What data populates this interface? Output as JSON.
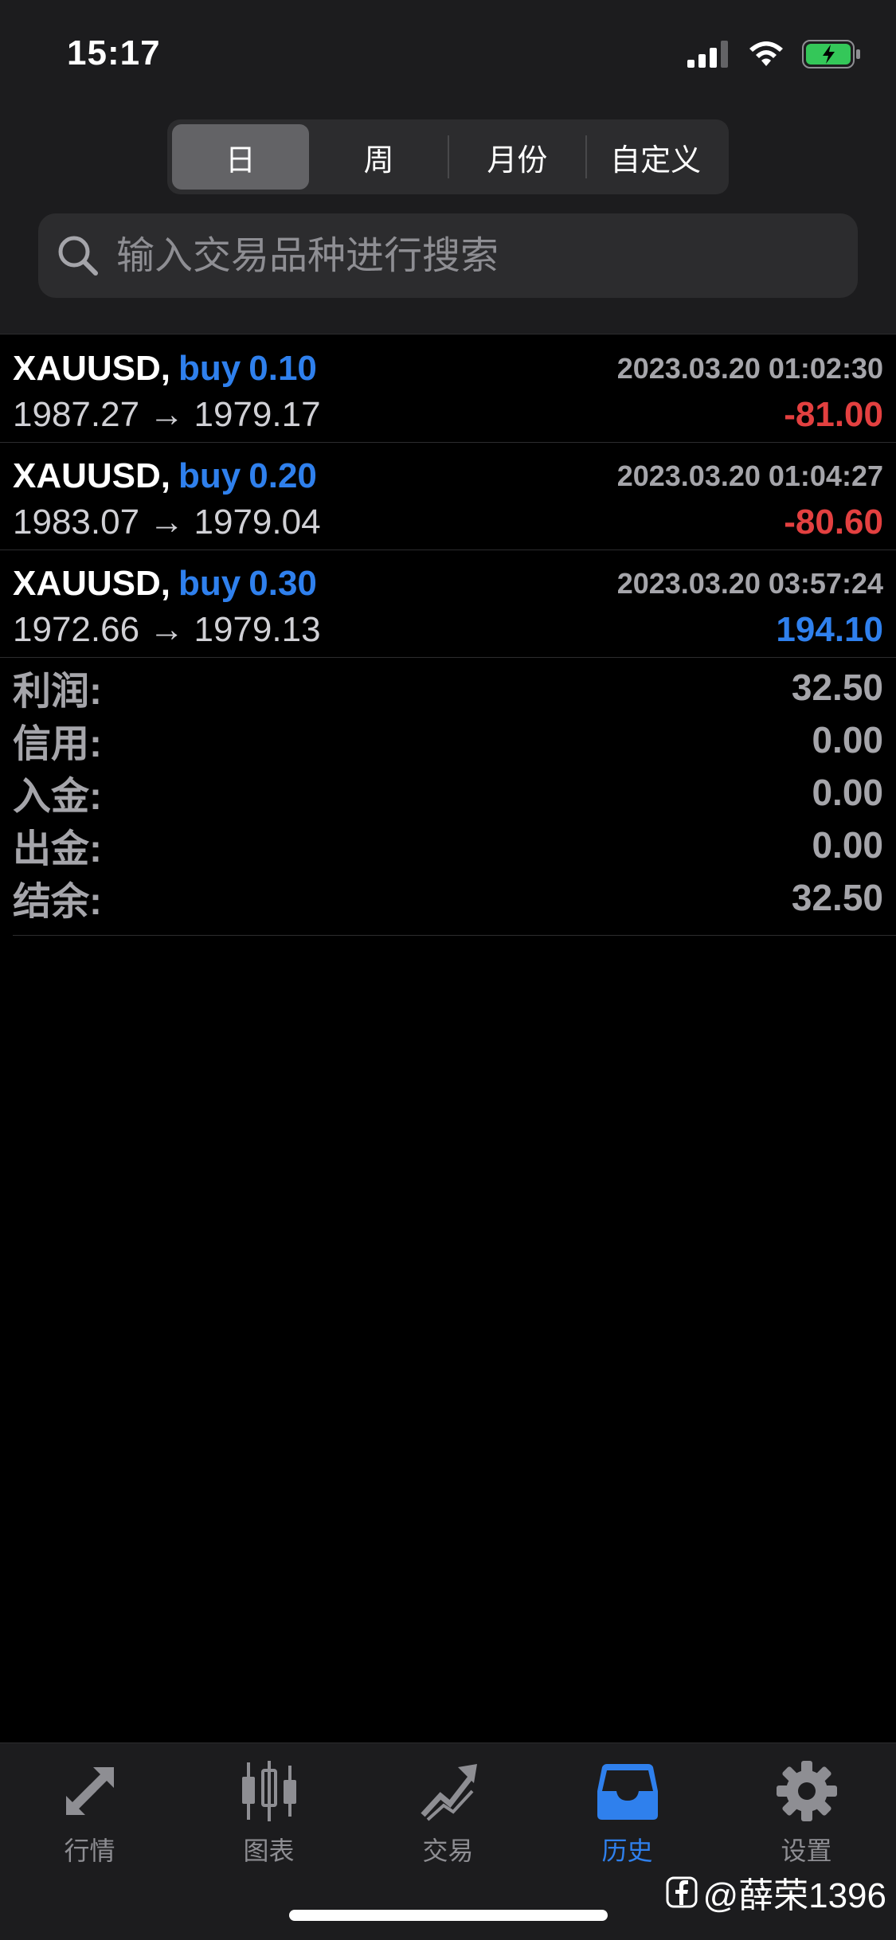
{
  "status": {
    "time": "15:17"
  },
  "period_tabs": [
    {
      "label": "日",
      "active": true
    },
    {
      "label": "周",
      "active": false
    },
    {
      "label": "月份",
      "active": false
    },
    {
      "label": "自定义",
      "active": false
    }
  ],
  "search": {
    "placeholder": "输入交易品种进行搜索"
  },
  "trades": [
    {
      "symbol": "XAUUSD,",
      "side": "buy",
      "volume": "0.10",
      "time": "2023.03.20 01:02:30",
      "prices": "1987.27 → 1979.17",
      "profit": "-81.00",
      "profit_sign": "negative"
    },
    {
      "symbol": "XAUUSD,",
      "side": "buy",
      "volume": "0.20",
      "time": "2023.03.20 01:04:27",
      "prices": "1983.07 → 1979.04",
      "profit": "-80.60",
      "profit_sign": "negative"
    },
    {
      "symbol": "XAUUSD,",
      "side": "buy",
      "volume": "0.30",
      "time": "2023.03.20 03:57:24",
      "prices": "1972.66 → 1979.13",
      "profit": "194.10",
      "profit_sign": "positive"
    }
  ],
  "summary": [
    {
      "label": "利润:",
      "value": "32.50"
    },
    {
      "label": "信用:",
      "value": "0.00"
    },
    {
      "label": "入金:",
      "value": "0.00"
    },
    {
      "label": "出金:",
      "value": "0.00"
    },
    {
      "label": "结余:",
      "value": "32.50"
    }
  ],
  "tab_bar": [
    {
      "label": "行情",
      "icon": "quotes-arrows-icon",
      "active": false
    },
    {
      "label": "图表",
      "icon": "candlestick-chart-icon",
      "active": false
    },
    {
      "label": "交易",
      "icon": "trade-trend-icon",
      "active": false
    },
    {
      "label": "历史",
      "icon": "history-inbox-icon",
      "active": true
    },
    {
      "label": "设置",
      "icon": "gear-icon",
      "active": false
    }
  ],
  "watermark": {
    "text": "@薛荣1396"
  },
  "colors": {
    "accent": "#2f80ed",
    "negative": "#e34040",
    "background": "#000000",
    "header_bg": "#1c1c1e",
    "muted": "#a5a5aa"
  }
}
